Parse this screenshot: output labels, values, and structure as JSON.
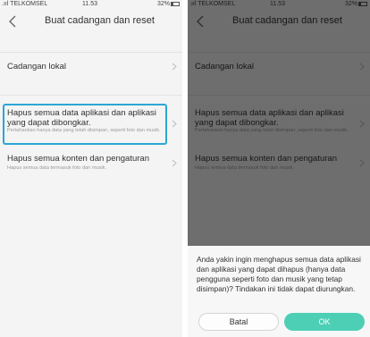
{
  "status_bar": {
    "carrier": ".ııl TELKOMSEL",
    "time": "11.53",
    "battery": "32%"
  },
  "header": {
    "title": "Buat cadangan dan reset"
  },
  "items": [
    {
      "label": "Cadangan lokal",
      "sub": ""
    },
    {
      "label": "Hapus semua data aplikasi dan aplikasi yang dapat dibongkar.",
      "sub": "Pertahankan hanya data yang telah disimpan, seperti foto dan musik."
    },
    {
      "label": "Hapus semua konten dan pengaturan",
      "sub": "Hapus semua data termasuk foto dan musik."
    }
  ],
  "dialog": {
    "message": "Anda yakin ingin menghapus semua data aplikasi dan aplikasi yang dapat dihapus (hanya data pengguna seperti foto dan musik yang tetap disimpan)? Tindakan ini tidak dapat diurungkan.",
    "cancel_label": "Batal",
    "ok_label": "OK"
  },
  "colors": {
    "highlight": "#2aa6d6",
    "ok_button": "#4dcfb5"
  },
  "icons": {
    "back": "chevron-left-icon",
    "row_arrow": "chevron-right-icon",
    "battery": "battery-icon"
  }
}
